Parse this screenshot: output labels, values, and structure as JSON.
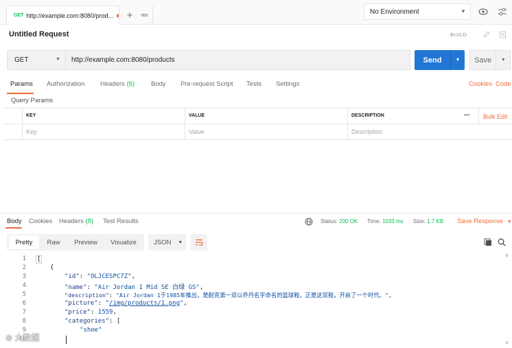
{
  "tab": {
    "method": "GET",
    "title": "http://example.com:8080/prod..."
  },
  "topbar": {
    "more_label": "ooo",
    "environment": "No Environment"
  },
  "request": {
    "title": "Untitled Request",
    "build_label": "BUILD",
    "method": "GET",
    "url": "http://example.com:8080/products",
    "send_label": "Send",
    "save_label": "Save"
  },
  "request_tabs": {
    "params": "Params",
    "authorization": "Authorization",
    "headers": "Headers",
    "headers_count": "(6)",
    "body": "Body",
    "prerequest": "Pre-request Script",
    "tests": "Tests",
    "settings": "Settings",
    "cookies": "Cookies",
    "code": "Code"
  },
  "params": {
    "section_title": "Query Params",
    "columns": {
      "key": "KEY",
      "value": "VALUE",
      "description": "DESCRIPTION"
    },
    "more": "•••",
    "bulk_edit": "Bulk Edit",
    "placeholders": {
      "key": "Key",
      "value": "Value",
      "description": "Description"
    }
  },
  "response": {
    "tabs": {
      "body": "Body",
      "cookies": "Cookies",
      "headers": "Headers",
      "headers_count": "(8)",
      "test_results": "Test Results"
    },
    "status_label": "Status:",
    "status_value": "200 OK",
    "time_label": "Time:",
    "time_value": "1033 ms",
    "size_label": "Size:",
    "size_value": "1.7 KB",
    "save_response": "Save Response",
    "formats": {
      "pretty": "Pretty",
      "raw": "Raw",
      "preview": "Preview",
      "visualize": "Visualize",
      "language": "JSON"
    },
    "line_numbers": [
      "1",
      "2",
      "3",
      "4",
      "5",
      "6",
      "7",
      "8",
      "9",
      "10"
    ],
    "code": {
      "l1": "[",
      "l2": "{",
      "id_key": "\"id\"",
      "id_val": "\"OLJCESPC7Z\"",
      "name_key": "\"name\"",
      "name_val": "\"Air Jordan 1 Mid SE 白绿 GS\"",
      "desc_key": "\"description\"",
      "desc_val": "\"Air Jordan 1于1985年推出，是耐克第一双以乔丹名字命名的篮球鞋，正是这双鞋，开启了一个时代。\"",
      "pic_key": "\"picture\"",
      "pic_q1": "\"",
      "pic_link": "/img/products/1.png",
      "pic_q2": "\"",
      "price_key": "\"price\"",
      "price_val": "1559",
      "cat_key": "\"categories\"",
      "cat_open": "[",
      "cat_item": "\"shoe\""
    }
  },
  "watermark": "大数据"
}
